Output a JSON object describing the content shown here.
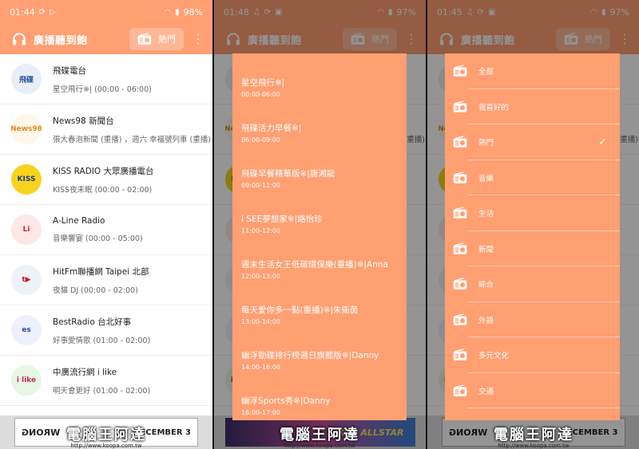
{
  "colors": {
    "accent": "#ff9f72",
    "accent_light": "#ffb896"
  },
  "app": {
    "title": "廣播聽到飽",
    "category_button": "熱門"
  },
  "screens": [
    {
      "time": "01:44",
      "battery": "98%"
    },
    {
      "time": "01:48",
      "battery": "97%"
    },
    {
      "time": "01:45",
      "battery": "97%"
    }
  ],
  "stations": [
    {
      "name": "飛碟電台",
      "program": "星空飛行※| (00:00 - 06:00)",
      "logo": "飛碟",
      "logo_bg": "#e9eef6",
      "logo_fg": "#1d4f9a"
    },
    {
      "name": "News98 新聞台",
      "program": "張大春泡新聞 (重播) ，週六 幸福號列車 (重播)",
      "logo": "News98",
      "logo_bg": "#fff7ea",
      "logo_fg": "#e08a1c"
    },
    {
      "name": "KISS RADIO 大眾廣播電台",
      "program": "KISS夜未眠 (00:00 - 02:00)",
      "logo": "KISS",
      "logo_bg": "#f7d21e",
      "logo_fg": "#1b3e8c"
    },
    {
      "name": "A-Line Radio",
      "program": "音樂響宴 (00:00 - 05:00)",
      "logo": "Li",
      "logo_bg": "#fde7e7",
      "logo_fg": "#d81f26"
    },
    {
      "name": "HitFm聯播網 Taipei 北部",
      "program": "夜貓 DJ (00:00 - 02:00)",
      "logo": "t▶",
      "logo_bg": "#eef2f8",
      "logo_fg": "#c9162c"
    },
    {
      "name": "BestRadio 台北好事",
      "program": "好事愛情歌 (01:00 - 02:00)",
      "logo": "es",
      "logo_bg": "#eef1fb",
      "logo_fg": "#2c47a8"
    },
    {
      "name": "中廣流行網 i like",
      "program": "明天會更好 (01:00 - 02:00)",
      "logo": "i like",
      "logo_bg": "#e8f6e4",
      "logo_fg": "#d8255f"
    }
  ],
  "program_dialog": [
    {
      "title": "星空飛行※|",
      "time": "00:00-06:00"
    },
    {
      "title": "飛碟活力早餐※|",
      "time": "06:00-09:00"
    },
    {
      "title": "飛碟早餐精華版※|唐湘龍",
      "time": "09:00-11:00"
    },
    {
      "title": "I SEE夢想家※|路怡珍",
      "time": "11:00-12:00"
    },
    {
      "title": "週末生活女王低碳環保樂(重播)※|Anna",
      "time": "12:00-13:00"
    },
    {
      "title": "每天愛你多一點(重播)※|朱衛茵",
      "time": "13:00-14:00"
    },
    {
      "title": "幽浮勁碟排行榜週日旗艦版※|Danny",
      "time": "14:00-16:00"
    },
    {
      "title": "幽浮Sports秀※|Danny",
      "time": "16:00-17:00"
    }
  ],
  "categories": [
    {
      "label": "全部",
      "selected": false
    },
    {
      "label": "我喜好的",
      "selected": false
    },
    {
      "label": "熱門",
      "selected": true
    },
    {
      "label": "音樂",
      "selected": false
    },
    {
      "label": "生活",
      "selected": false
    },
    {
      "label": "新聞",
      "selected": false
    },
    {
      "label": "綜合",
      "selected": false
    },
    {
      "label": "外語",
      "selected": false
    },
    {
      "label": "多元文化",
      "selected": false
    },
    {
      "label": "交通",
      "selected": false
    }
  ],
  "ads": {
    "left": {
      "headline": "DECEMBER 3",
      "sub": "DR PHILLIPS CENTER",
      "mirror": "WRONG"
    },
    "middle": {
      "headline": "KOF ALLSTAR"
    }
  },
  "watermark": {
    "text": "電腦王阿達",
    "url": "http://www.koopa.com.tw"
  },
  "icons": {
    "check": "✓",
    "more": "⋮"
  }
}
